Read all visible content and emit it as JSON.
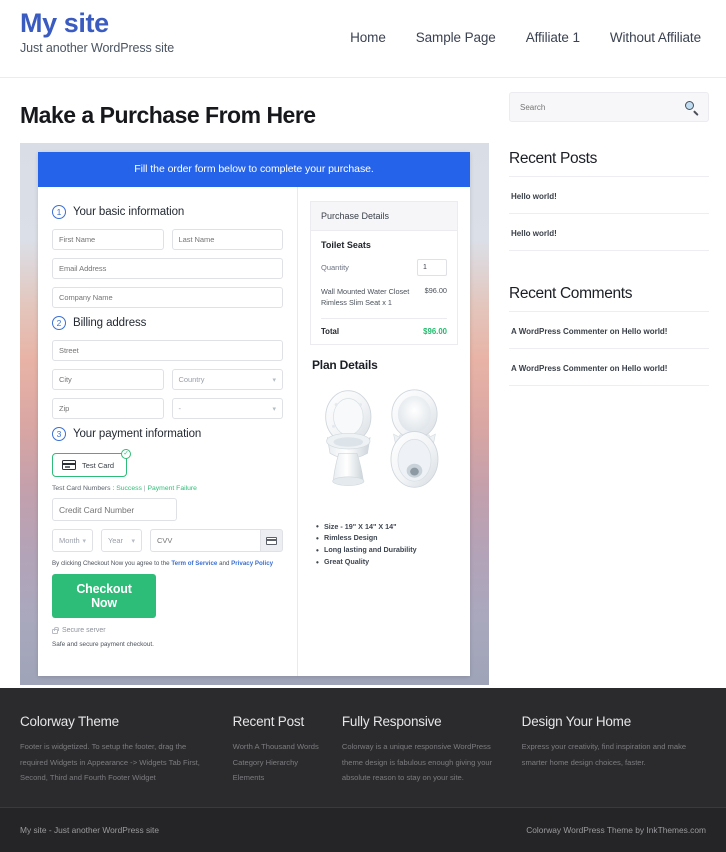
{
  "header": {
    "brand_title": "My site",
    "brand_tagline": "Just another WordPress site",
    "nav": [
      {
        "label": "Home"
      },
      {
        "label": "Sample Page"
      },
      {
        "label": "Affiliate 1"
      },
      {
        "label": "Without Affiliate"
      }
    ]
  },
  "main": {
    "page_title": "Make a Purchase From Here",
    "order_banner": "Fill the order form below to complete your purchase.",
    "steps": {
      "step1_num": "1",
      "step1_label": "Your basic information",
      "step2_num": "2",
      "step2_label": "Billing address",
      "step3_num": "3",
      "step3_label": "Your payment information"
    },
    "fields": {
      "first_name": "First Name",
      "last_name": "Last Name",
      "email": "Email Address",
      "company": "Company Name",
      "street": "Street",
      "city": "City",
      "country": "Country",
      "zip": "Zip",
      "state": "-",
      "credit_card": "Credit Card Number",
      "month": "Month",
      "year": "Year",
      "cvv": "CVV"
    },
    "payment": {
      "card_option_label": "Test Card",
      "card_icon": "credit-card-icon",
      "selected_icon": "check-circle-icon",
      "test_numbers_prefix": "Test Card Numbers :",
      "test_success": "Success",
      "test_sep": "|",
      "test_failure": "Payment Failure",
      "agree_prefix": "By clicking Checkout Now you agree to the",
      "agree_tos": "Term of Service",
      "agree_and": "and",
      "agree_privacy": "Privacy Policy",
      "checkout_label": "Checkout Now",
      "secure_icon": "lock-icon",
      "secure_label": "Secure server",
      "safe_text": "Safe and secure payment checkout."
    },
    "purchase_details": {
      "heading": "Purchase Details",
      "product": "Toilet Seats",
      "quantity_label": "Quantity",
      "quantity_value": "1",
      "line_desc": "Wall Mounted Water Closet Rimless Slim Seat x 1",
      "line_amount": "$96.00",
      "total_label": "Total",
      "total_amount": "$96.00"
    },
    "plan": {
      "title": "Plan Details",
      "image_alt": "toilet-seats-product-image",
      "bullets": [
        "Size - 19\" X 14\" X 14\"",
        "Rimless Design",
        "Long lasting and Durability",
        "Great Quality"
      ]
    }
  },
  "sidebar": {
    "search_placeholder": "Search",
    "search_icon": "search-icon",
    "recent_posts_title": "Recent Posts",
    "recent_posts": [
      {
        "label": "Hello world!"
      },
      {
        "label": "Hello world!"
      }
    ],
    "recent_comments_title": "Recent Comments",
    "recent_comments": [
      {
        "label": "A WordPress Commenter on Hello world!"
      },
      {
        "label": "A WordPress Commenter on Hello world!"
      }
    ]
  },
  "footer": {
    "columns": [
      {
        "title": "Colorway Theme",
        "text": "Footer is widgetized. To setup the footer, drag the required Widgets in Appearance -> Widgets Tab First, Second, Third and Fourth Footer Widget"
      },
      {
        "title": "Recent Post",
        "items": [
          {
            "label": "Worth A Thousand Words"
          },
          {
            "label": "Category Hierarchy"
          },
          {
            "label": "Elements"
          }
        ]
      },
      {
        "title": "Fully Responsive",
        "text": "Colorway is a unique responsive WordPress theme design is fabulous enough giving your absolute reason to stay on your site."
      },
      {
        "title": "Design Your Home",
        "text": "Express your creativity, find inspiration and make smarter home design choices, faster."
      }
    ],
    "copyright_left": "My site - Just another WordPress site",
    "copyright_right": "Colorway WordPress Theme by InkThemes.com"
  },
  "colors": {
    "brand": "#3a5bbf",
    "banner": "#2563eb",
    "accent_green": "#2ebd78",
    "total_green": "#22bb6e",
    "footer_bg": "#2b2b2d"
  }
}
